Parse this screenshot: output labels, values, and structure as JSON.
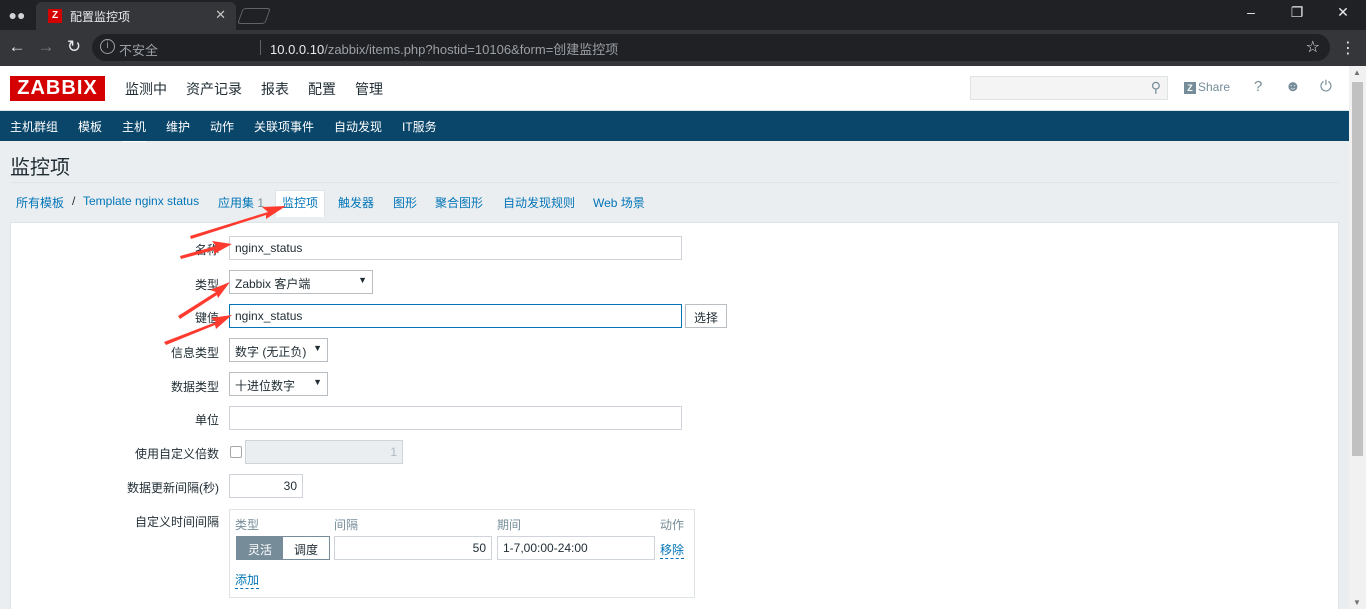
{
  "browser": {
    "tab_title": "配置监控项",
    "favicon_letter": "Z",
    "security_label": "不安全",
    "url_host": "10.0.0.10",
    "url_path": "/zabbix/items.php?hostid=10106&form=创建监控项"
  },
  "header": {
    "logo": "ZABBIX",
    "menu": [
      "监测中",
      "资产记录",
      "报表",
      "配置",
      "管理"
    ],
    "active_menu": "配置",
    "search_placeholder": "",
    "share_label": "Share",
    "help_label": "?"
  },
  "sub_menu": {
    "items": [
      "主机群组",
      "模板",
      "主机",
      "维护",
      "动作",
      "关联项事件",
      "自动发现",
      "IT服务"
    ],
    "active": "主机"
  },
  "page": {
    "title": "监控项"
  },
  "breadcrumb": {
    "all_templates": "所有模板",
    "separator": "/",
    "template": "Template nginx status",
    "app_label": "应用集",
    "app_count": "1",
    "tabs": [
      "监控项",
      "触发器",
      "图形",
      "聚合图形",
      "自动发现规则",
      "Web 场景"
    ],
    "active_tab": "监控项"
  },
  "form": {
    "name_label": "名称",
    "name_value": "nginx_status",
    "type_label": "类型",
    "type_value": "Zabbix 客户端",
    "key_label": "键值",
    "key_value": "nginx_status",
    "key_select_button": "选择",
    "info_type_label": "信息类型",
    "info_type_value": "数字 (无正负)",
    "data_type_label": "数据类型",
    "data_type_value": "十进位数字",
    "units_label": "单位",
    "units_value": "",
    "multiplier_label": "使用自定义倍数",
    "multiplier_checked": false,
    "multiplier_value": "1",
    "update_interval_label": "数据更新间隔(秒)",
    "update_interval_value": "30",
    "custom_intervals_label": "自定义时间间隔",
    "custom_intervals": {
      "headers": [
        "类型",
        "间隔",
        "期间",
        "动作"
      ],
      "row": {
        "type_options": [
          "灵活",
          "调度"
        ],
        "type_selected": "灵活",
        "interval": "50",
        "period": "1-7,00:00-24:00",
        "remove_label": "移除"
      },
      "add_label": "添加"
    }
  },
  "colors": {
    "logo_red": "#d40000",
    "submenu_blue": "#0a466a",
    "link_blue": "#0275b8",
    "annotation_red": "#ff3b30"
  }
}
